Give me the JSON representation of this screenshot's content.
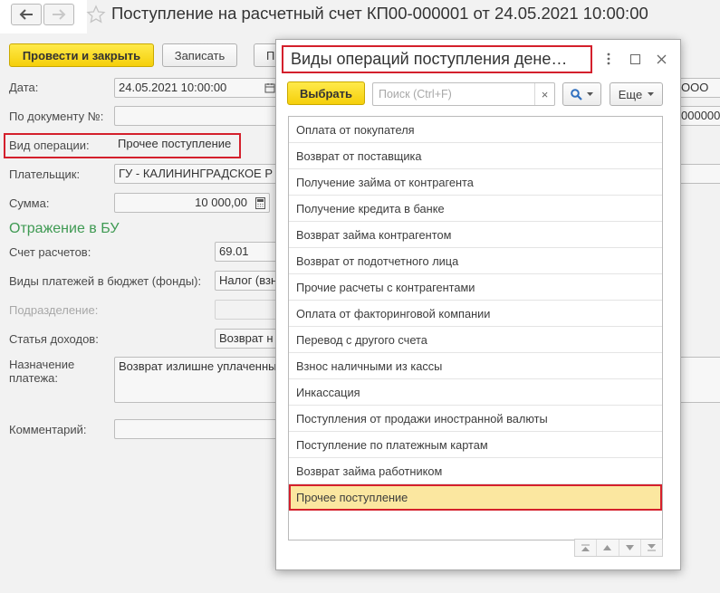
{
  "window": {
    "title": "Поступление на расчетный счет КП00-000001 от 24.05.2021 10:00:00"
  },
  "toolbar": {
    "post_close": "Провести и закрыть",
    "save": "Записать",
    "partial_button": "П"
  },
  "form": {
    "date_label": "Дата:",
    "date_value": "24.05.2021 10:00:00",
    "docnum_label": "По документу №:",
    "operation_label": "Вид операции:",
    "operation_value": "Прочее поступление",
    "payer_label": "Плательщик:",
    "payer_value": "ГУ - КАЛИНИНГРАДСКОЕ Р",
    "sum_label": "Сумма:",
    "sum_value": "10 000,00",
    "section_bu": "Отражение в БУ",
    "account_label": "Счет расчетов:",
    "account_value": "69.01",
    "budget_label": "Виды платежей в бюджет (фонды):",
    "budget_value": "Налог (взн",
    "division_label": "Подразделение:",
    "income_label": "Статья доходов:",
    "income_value": "Возврат н",
    "purpose_label_1": "Назначение",
    "purpose_label_2": "платежа:",
    "purpose_value": "Возврат излишне уплаченны",
    "comment_label": "Комментарий:",
    "right_org_value": "ООО",
    "right_num_value": "0000000"
  },
  "dialog": {
    "title": "Виды операций поступления дене…",
    "select_button": "Выбрать",
    "search_placeholder": "Поиск (Ctrl+F)",
    "more_button": "Еще",
    "items": [
      "Оплата от покупателя",
      "Возврат от поставщика",
      "Получение займа от контрагента",
      "Получение кредита в банке",
      "Возврат займа контрагентом",
      "Возврат от подотчетного лица",
      "Прочие расчеты с контрагентами",
      "Оплата от факторинговой компании",
      "Перевод с другого счета",
      "Взнос наличными из кассы",
      "Инкассация",
      "Поступления от продажи иностранной валюты",
      "Поступление по платежным картам",
      "Возврат займа работником",
      "Прочее поступление"
    ],
    "selected_index": 14
  },
  "colors": {
    "primary_button": "#f5cf0a",
    "highlight_frame": "#d4202c",
    "selected_row": "#fbe7a0",
    "section_title": "#3f9a53"
  }
}
